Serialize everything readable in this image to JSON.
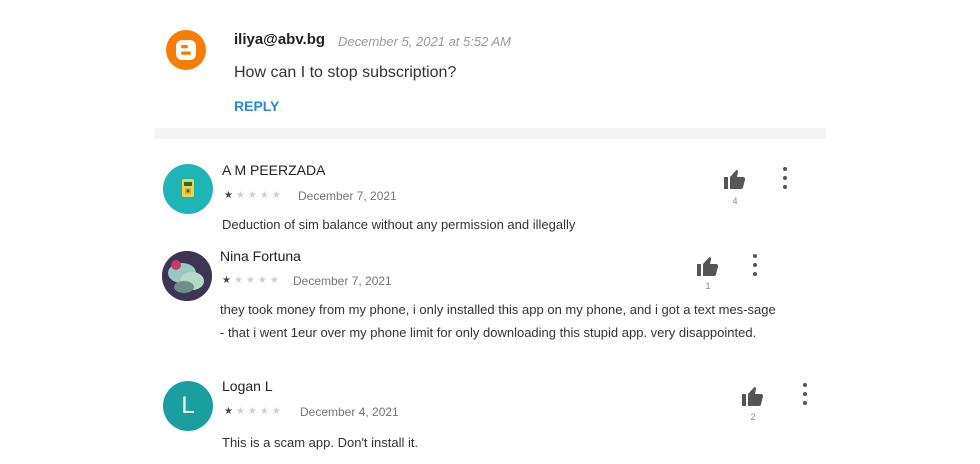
{
  "blog_comment": {
    "author": "iliya@abv.bg",
    "date": "December 5, 2021 at 5:52 AM",
    "text": "How can I to stop subscription?",
    "reply_label": "REPLY"
  },
  "reviews": [
    {
      "name": "A M PEERZADA",
      "stars": "★",
      "stars_off": "★★★★",
      "rating": 1,
      "date": "December 7, 2021",
      "text": "Deduction of sim balance without any permission and illegally",
      "likes": "4",
      "avatar_color": "#1fb5b5"
    },
    {
      "name": "Nina Fortuna",
      "stars": "★",
      "stars_off": "★★★★",
      "rating": 1,
      "date": "December 7, 2021",
      "text": "they took money from my phone, i only installed this app on my phone, and i got a text mes-sage - that i went 1eur over my phone limit for only downloading this stupid app. very disappointed.",
      "likes": "1",
      "avatar_color": "#5b4a6a"
    },
    {
      "name": "Logan L",
      "initial": "L",
      "stars": "★",
      "stars_off": "★★★★",
      "rating": 1,
      "date": "December 4, 2021",
      "text": "This is a scam app. Don't install it.",
      "likes": "2",
      "avatar_color": "#1a9ea0"
    }
  ],
  "colors": {
    "reply": "#2a87d0",
    "blogger_orange": "#f57d00"
  }
}
